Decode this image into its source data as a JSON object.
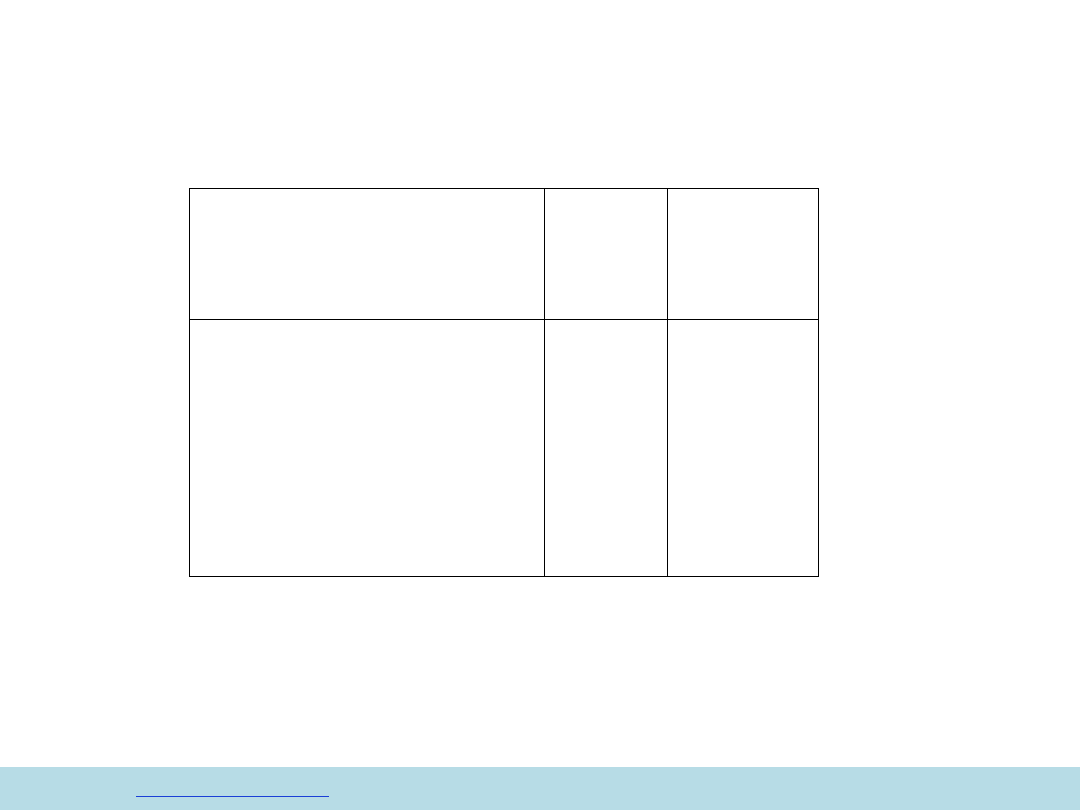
{
  "slide": {
    "background": "#ffffff"
  },
  "table": {
    "border_color": "#000000",
    "rows": [
      [
        "",
        "",
        ""
      ],
      [
        "",
        "",
        ""
      ]
    ]
  },
  "footer": {
    "band_color": "#b7dce6",
    "link_text": "",
    "link_color": "#1a3fd6"
  }
}
